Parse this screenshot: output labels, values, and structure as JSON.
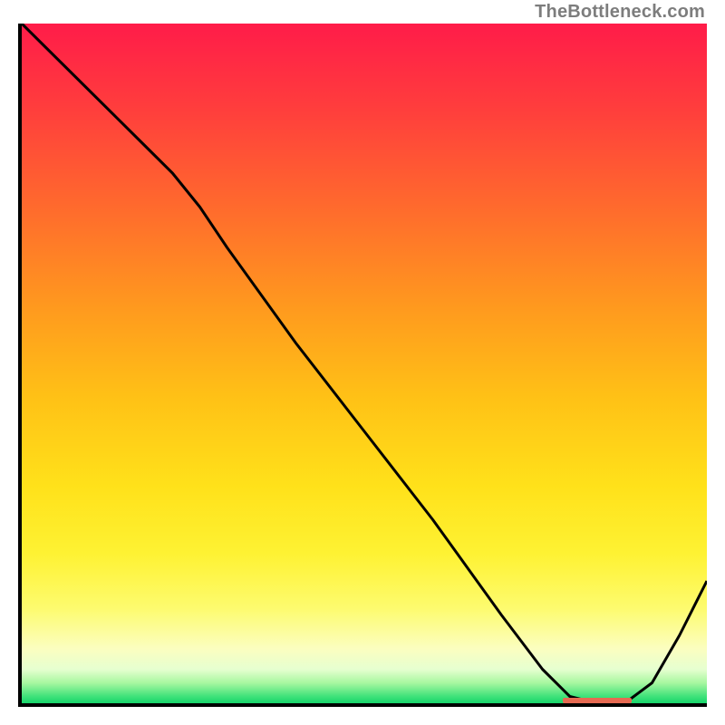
{
  "attribution": "TheBottleneck.com",
  "colors": {
    "gradient_top": "#ff1c49",
    "gradient_bottom": "#18d56b",
    "curve": "#000000",
    "marker": "#e66a52",
    "axis": "#000000",
    "text": "#7d7d7d"
  },
  "chart_data": {
    "type": "line",
    "title": "",
    "xlabel": "",
    "ylabel": "",
    "xlim": [
      0,
      100
    ],
    "ylim": [
      0,
      100
    ],
    "series": [
      {
        "name": "bottleneck-curve",
        "x": [
          0,
          4,
          10,
          18,
          22,
          26,
          30,
          40,
          50,
          60,
          70,
          76,
          80,
          84,
          88,
          92,
          96,
          100
        ],
        "y": [
          100,
          96,
          90,
          82,
          78,
          73,
          67,
          53,
          40,
          27,
          13,
          5,
          1,
          0,
          0,
          3,
          10,
          18
        ]
      }
    ],
    "annotations": [
      {
        "name": "optimal-band",
        "x_start": 79,
        "x_end": 89,
        "y": 0
      }
    ],
    "background_gradient": {
      "orientation": "vertical",
      "stops": [
        {
          "pos": 0.0,
          "color": "#ff1c49"
        },
        {
          "pos": 0.12,
          "color": "#ff3c3d"
        },
        {
          "pos": 0.27,
          "color": "#ff6a2d"
        },
        {
          "pos": 0.42,
          "color": "#ff9a1e"
        },
        {
          "pos": 0.55,
          "color": "#ffc116"
        },
        {
          "pos": 0.68,
          "color": "#ffe11a"
        },
        {
          "pos": 0.78,
          "color": "#fef233"
        },
        {
          "pos": 0.86,
          "color": "#fdfb6e"
        },
        {
          "pos": 0.92,
          "color": "#fbfec0"
        },
        {
          "pos": 0.95,
          "color": "#e6ffd0"
        },
        {
          "pos": 0.97,
          "color": "#a8f7a0"
        },
        {
          "pos": 0.99,
          "color": "#3fe27a"
        },
        {
          "pos": 1.0,
          "color": "#18d56b"
        }
      ]
    }
  }
}
